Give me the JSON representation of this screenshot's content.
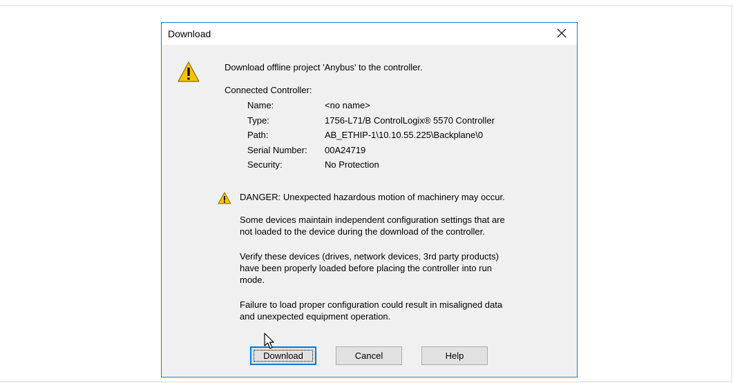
{
  "dialog": {
    "title": "Download",
    "message": "Download offline project 'Anybus' to the controller.",
    "connected_label": "Connected Controller:",
    "controller": [
      {
        "label": "Name:",
        "value": "<no name>"
      },
      {
        "label": "Type:",
        "value": "1756-L71/B ControlLogix® 5570 Controller"
      },
      {
        "label": "Path:",
        "value": "AB_ETHIP-1\\10.10.55.225\\Backplane\\0"
      },
      {
        "label": "Serial Number:",
        "value": "00A24719"
      },
      {
        "label": "Security:",
        "value": "No Protection"
      }
    ],
    "danger": "DANGER: Unexpected hazardous motion of machinery may occur.",
    "paragraphs": [
      [
        "Some devices maintain independent configuration settings that are",
        "not loaded to the device during the download of the controller."
      ],
      [
        "Verify these devices (drives, network devices, 3rd party products)",
        "have been properly loaded before placing the controller into run",
        "mode."
      ],
      [
        "Failure to load proper configuration could result in misaligned data",
        "and unexpected equipment operation."
      ]
    ],
    "buttons": {
      "download": "Download",
      "cancel": "Cancel",
      "help": "Help"
    }
  },
  "icons": {
    "close": "close-icon",
    "warning": "warning-icon",
    "cursor": "mouse-pointer-icon"
  },
  "colors": {
    "dialog_bg": "#f0f0f0",
    "titlebar_bg": "#ffffff",
    "border_accent": "#1979ca",
    "default_button_border": "#0078d7",
    "warning_yellow": "#f5c400"
  }
}
